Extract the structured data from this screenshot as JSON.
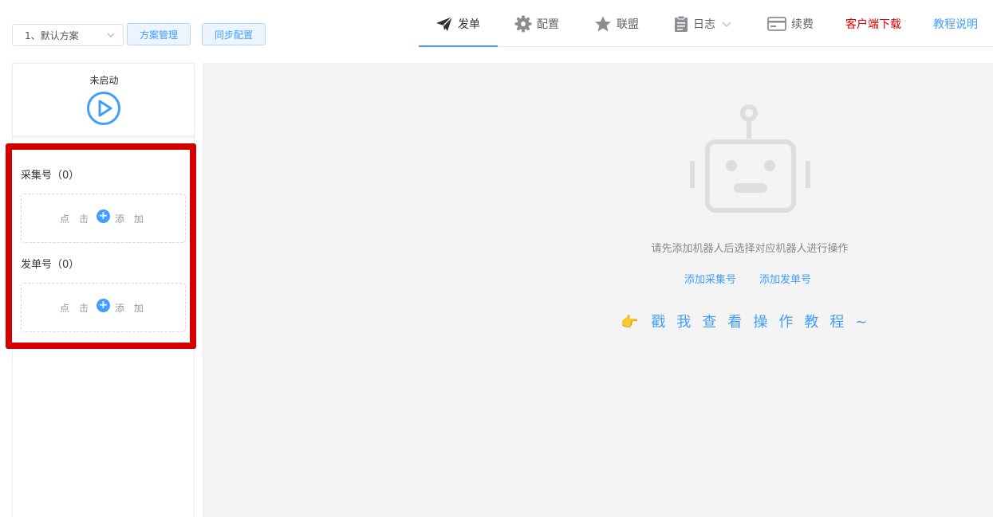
{
  "header": {
    "scheme_select_value": "1、默认方案",
    "scheme_manage_label": "方案管理",
    "sync_config_label": "同步配置"
  },
  "nav": {
    "items": [
      {
        "label": "发单",
        "icon": "paper-plane-icon",
        "active": true
      },
      {
        "label": "配置",
        "icon": "gear-icon"
      },
      {
        "label": "联盟",
        "icon": "star-icon"
      },
      {
        "label": "日志",
        "icon": "clipboard-icon",
        "dropdown": true
      },
      {
        "label": "续费",
        "icon": "card-icon"
      }
    ],
    "client_download": "客户端下载",
    "tutorial_link": "教程说明"
  },
  "sidebar": {
    "status_text": "未启动",
    "collect_title": "采集号（0）",
    "send_title": "发单号（0）",
    "add_click": "点 击",
    "add_word": "添 加",
    "plus_glyph": "+"
  },
  "main": {
    "empty_hint": "请先添加机器人后选择对应机器人进行操作",
    "add_collect_link": "添加采集号",
    "add_send_link": "添加发单号",
    "tutorial_hand": "👉",
    "tutorial_text": "戳我查看操作教程~"
  },
  "colors": {
    "accent": "#409eff",
    "highlight": "#d40000",
    "download": "#e00000"
  }
}
